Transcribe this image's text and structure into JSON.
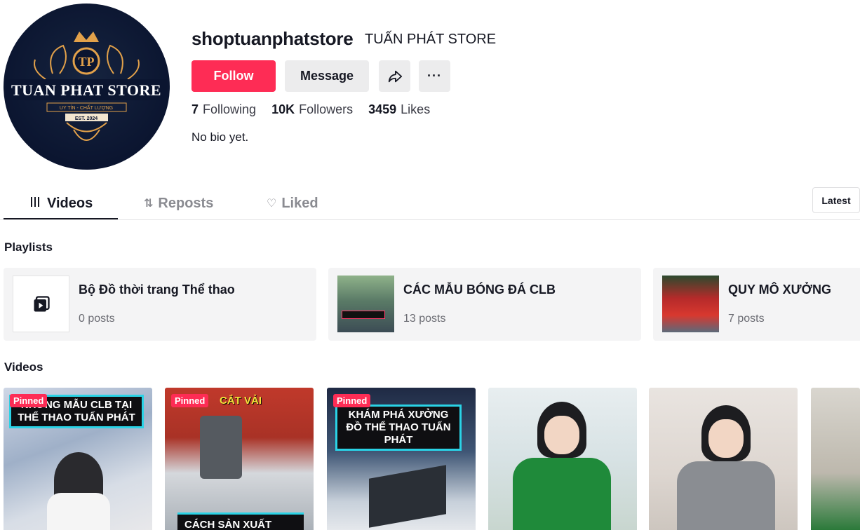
{
  "profile": {
    "username": "shoptuanphatstore",
    "nickname": "TUẤN PHÁT STORE",
    "bio": "No bio yet.",
    "logo": {
      "monogram": "TP",
      "name": "TUAN PHAT STORE",
      "tagline": "UY TÍN - CHẤT LƯỢNG",
      "est": "EST. 2024"
    }
  },
  "actions": {
    "follow_label": "Follow",
    "message_label": "Message",
    "share_icon": "share-icon",
    "more_label": "···"
  },
  "stats": {
    "following_count": "7",
    "following_label": "Following",
    "followers_count": "10K",
    "followers_label": "Followers",
    "likes_count": "3459",
    "likes_label": "Likes"
  },
  "tabs": [
    {
      "label": "Videos",
      "icon": "grid-icon"
    },
    {
      "label": "Reposts",
      "icon": "repost-icon"
    },
    {
      "label": "Liked",
      "icon": "heart-slash-icon"
    }
  ],
  "sort_label": "Latest",
  "sections": {
    "playlists_title": "Playlists",
    "videos_title": "Videos"
  },
  "playlists": [
    {
      "title": "Bộ Đồ thời trang Thể thao",
      "count": "0 posts"
    },
    {
      "title": "CÁC MẪU BÓNG ĐÁ CLB",
      "count": "13 posts"
    },
    {
      "title": "QUY MÔ XƯỞNG",
      "count": "7 posts"
    }
  ],
  "videos": [
    {
      "pinned": "Pinned",
      "caption": "NHỮNG MẪU CLB TẠI THỂ THAO TUẤN PHÁT"
    },
    {
      "pinned": "Pinned",
      "caption": "CẮT VẢI",
      "bottom_caption": "CÁCH SẢN XUẤT MỘT"
    },
    {
      "pinned": "Pinned",
      "caption": "KHÁM PHÁ XƯỞNG ĐỒ THỂ THAO TUẤN PHÁT"
    },
    {
      "pinned": "",
      "caption": ""
    },
    {
      "pinned": "",
      "caption": ""
    },
    {
      "pinned": "",
      "caption": ""
    }
  ],
  "colors": {
    "accent": "#fe2c55",
    "caption_border": "#2ad3e6",
    "logo_gold": "#e2a14a",
    "logo_navy": "#0b1530"
  }
}
